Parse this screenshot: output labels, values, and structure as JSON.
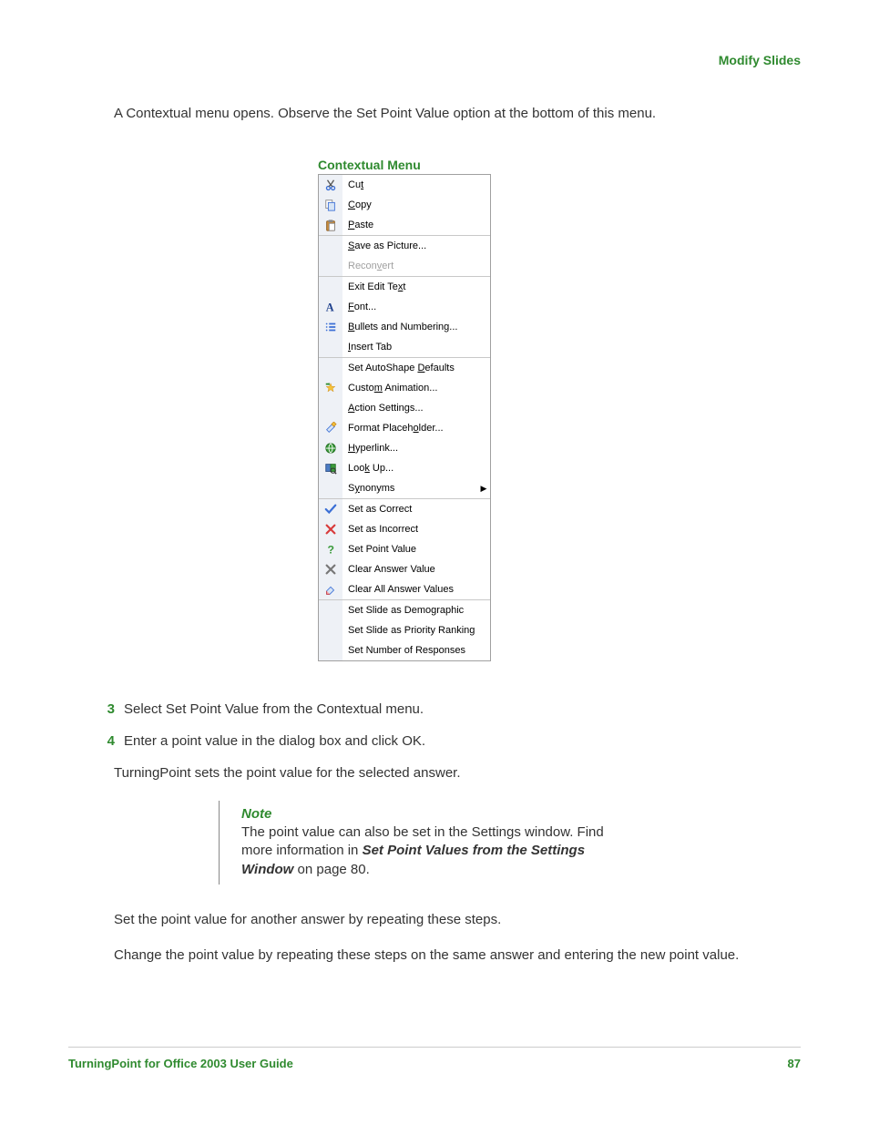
{
  "header": "Modify Slides",
  "intro": "A Contextual menu opens. Observe the Set Point Value option at the bottom of this menu.",
  "menu_title": "Contextual Menu",
  "menu": {
    "g1": [
      {
        "icon": "cut",
        "label": "Cu<u>t</u>"
      },
      {
        "icon": "copy",
        "label": "<u>C</u>opy"
      },
      {
        "icon": "paste",
        "label": "<u>P</u>aste"
      }
    ],
    "g2": [
      {
        "icon": "",
        "label": "<u>S</u>ave as Picture..."
      },
      {
        "icon": "",
        "label": "Recon<u>v</u>ert",
        "disabled": true
      }
    ],
    "g3": [
      {
        "icon": "",
        "label": "Exit Edit Te<u>x</u>t"
      },
      {
        "icon": "fontA",
        "label": "<u>F</u>ont..."
      },
      {
        "icon": "bullets",
        "label": "<u>B</u>ullets and Numbering..."
      },
      {
        "icon": "",
        "label": "<u>I</u>nsert Tab"
      }
    ],
    "g4": [
      {
        "icon": "",
        "label": "Set AutoShape <u>D</u>efaults"
      },
      {
        "icon": "anim",
        "label": "Custo<u>m</u> Animation..."
      },
      {
        "icon": "",
        "label": "<u>A</u>ction Settings..."
      },
      {
        "icon": "format",
        "label": "Format Placeh<u>o</u>lder..."
      },
      {
        "icon": "hyper",
        "label": "<u>H</u>yperlink..."
      },
      {
        "icon": "lookup",
        "label": "Loo<u>k</u> Up..."
      },
      {
        "icon": "",
        "label": "S<u>y</u>nonyms",
        "arrow": true
      }
    ],
    "g5": [
      {
        "icon": "check",
        "label": "Set as Correct"
      },
      {
        "icon": "xred",
        "label": "Set as Incorrect"
      },
      {
        "icon": "qmark",
        "label": "Set Point Value"
      },
      {
        "icon": "xgray",
        "label": "Clear Answer Value"
      },
      {
        "icon": "eraser",
        "label": "Clear All Answer Values"
      }
    ],
    "g6": [
      {
        "icon": "",
        "label": "Set Slide as Demographic"
      },
      {
        "icon": "",
        "label": "Set Slide as Priority Ranking"
      },
      {
        "icon": "",
        "label": "Set Number of Responses"
      }
    ]
  },
  "step3_num": "3",
  "step3": "Select Set Point Value from the Contextual menu.",
  "step4_num": "4",
  "step4": "Enter a point value in the dialog box and click OK.",
  "body1": "TurningPoint sets the point value for the selected answer.",
  "note_title": "Note",
  "note_body": "The point value can also be set in the Settings window. Find more information in <b>Set Point Values from the Settings Window</b> on page 80.",
  "body2": "Set the point value for another answer by repeating these steps.",
  "body3": "Change the point value by repeating these steps on the same answer and entering the new point value.",
  "footer_left": "TurningPoint for Office 2003 User Guide",
  "footer_right": "87"
}
